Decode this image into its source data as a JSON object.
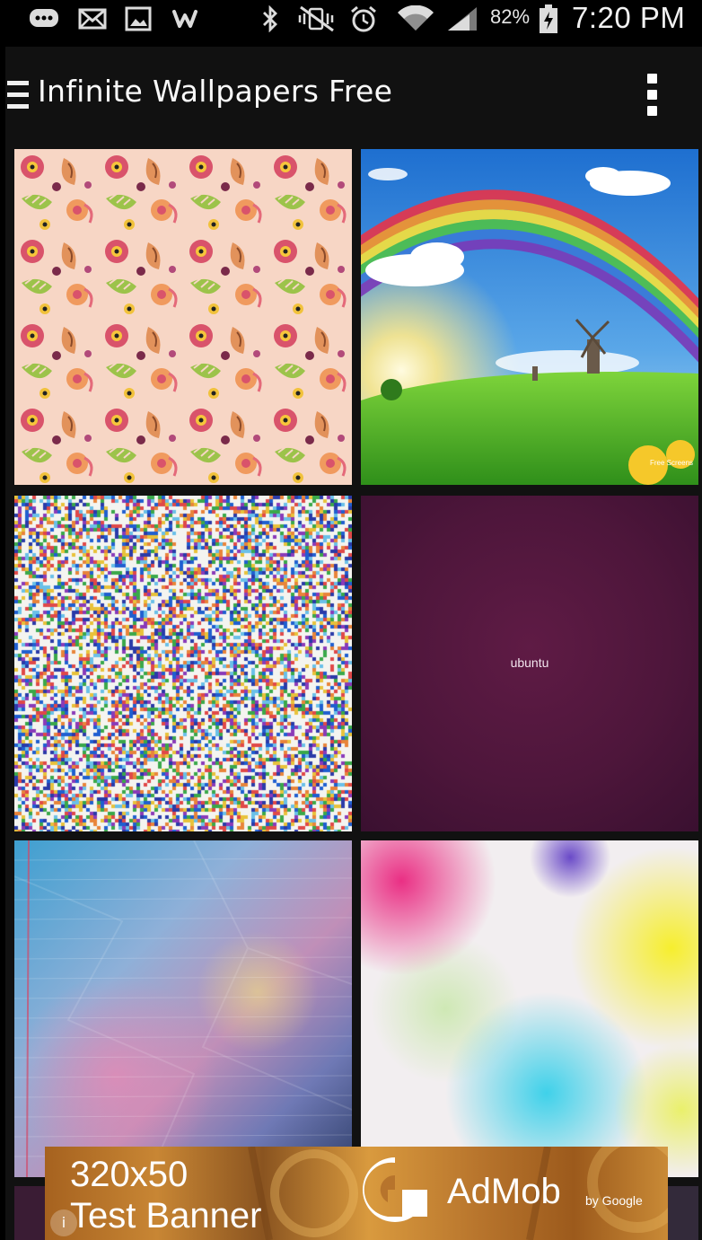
{
  "status_bar": {
    "battery_percent": "82%",
    "time": "7:20 PM",
    "icons": [
      "chat-bubble-icon",
      "mail-icon",
      "image-icon",
      "w-app-icon",
      "bluetooth-icon",
      "vibrate-mute-icon",
      "alarm-icon",
      "wifi-icon",
      "signal-icon",
      "battery-charging-icon"
    ]
  },
  "app_bar": {
    "title": "Infinite Wallpapers Free",
    "menu_icon": "hamburger-menu-icon",
    "overflow_icon": "overflow-menu-icon"
  },
  "wallpapers": [
    {
      "name": "floral-pattern"
    },
    {
      "name": "rainbow-landscape"
    },
    {
      "name": "confetti-noise"
    },
    {
      "name": "ubuntu-purple",
      "label": "ubuntu"
    },
    {
      "name": "crumpled-paper-watercolor"
    },
    {
      "name": "watercolor-splashes"
    },
    {
      "name": "partial-tile-7"
    },
    {
      "name": "partial-tile-8"
    }
  ],
  "rainbow_watermark": "Free Screens",
  "ad_banner": {
    "line1": "320x50",
    "line2": "Test Banner",
    "brand": "AdMob",
    "byline": "by Google",
    "info_glyph": "i"
  },
  "colors": {
    "status_bar_bg": "#000000",
    "app_bar_bg": "#111111",
    "ubuntu_purple": "#4e163b",
    "ad_orange": "#c88634"
  }
}
